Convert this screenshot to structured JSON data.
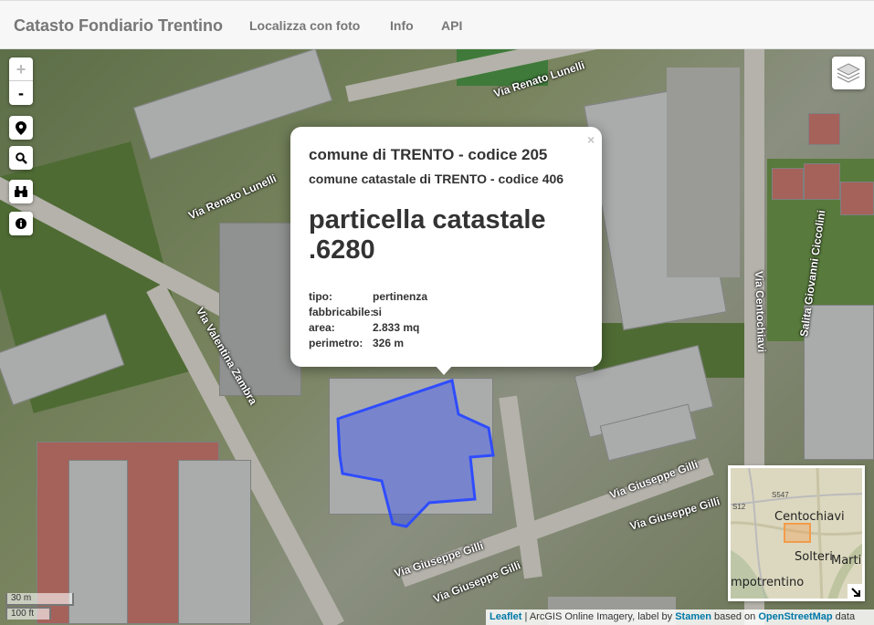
{
  "app": {
    "brand": "Catasto Fondiario Trentino",
    "nav": [
      "Localizza con foto",
      "Info",
      "API"
    ]
  },
  "map_controls": {
    "zoom_in": "+",
    "zoom_out": "-",
    "tools": [
      "location-pin-icon",
      "search-icon",
      "binoculars-icon",
      "info-icon"
    ],
    "layers": "layers-icon"
  },
  "roads": {
    "lunelli_1": "Via Renato Lunelli",
    "lunelli_2": "Via Renato Lunelli",
    "zambra": "Via Valentina Zambra",
    "centochiavi": "Via Centochiavi",
    "ciccolini": "Salita Giovanni Ciccolini",
    "gilli_1": "Via Giuseppe Gilli",
    "gilli_2": "Via Giuseppe Gilli",
    "gilli_3": "Via Giuseppe Gilli",
    "gilli_4": "Via Giuseppe Gilli"
  },
  "popup": {
    "close": "×",
    "comune": "comune di TRENTO - codice 205",
    "comune_catastale": "comune catastale di TRENTO - codice 406",
    "particella": "particella catastale .6280",
    "fields": [
      {
        "label": "tipo:",
        "value": "pertinenza"
      },
      {
        "label": "fabbricabile:",
        "value": "si"
      },
      {
        "label": "area:",
        "value": "2.833 mq"
      },
      {
        "label": "perimetro:",
        "value": "326 m"
      }
    ]
  },
  "minimap": {
    "labels": [
      "Centochiavi",
      "Solteri",
      "Martig",
      "mpotrentino"
    ],
    "road_codes": [
      "S547",
      "S12"
    ],
    "toggle_icon": "arrow-icon"
  },
  "scale": {
    "metric": "30 m",
    "imperial": "100 ft"
  },
  "attribution": {
    "leaflet": "Leaflet",
    "imagery": " | ArcGIS Online Imagery, label by ",
    "stamen": "Stamen",
    "based_on": " based on ",
    "osm": "OpenStreetMap",
    "data": " data"
  },
  "colors": {
    "parcel": "#2f4cff",
    "brand": "#777777",
    "link": "#0078a8"
  }
}
